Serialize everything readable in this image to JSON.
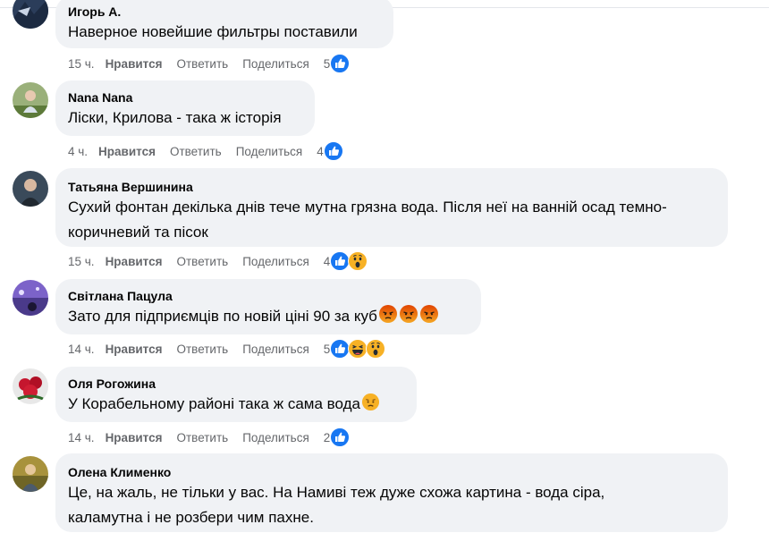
{
  "comments": [
    {
      "author": "Игорь А.",
      "lines": [
        "Наверное новейшие фильтры поставили"
      ],
      "time": "15 ч.",
      "like_label": "Нравится",
      "reply_label": "Ответить",
      "share_label": "Поделиться",
      "reactions_count": "5",
      "reactions": [
        "like-icon"
      ]
    },
    {
      "author": "Nana Nana",
      "lines": [
        "Ліски, Крилова - така ж історія"
      ],
      "time": "4 ч.",
      "like_label": "Нравится",
      "reply_label": "Ответить",
      "share_label": "Поделиться",
      "reactions_count": "4",
      "reactions": [
        "like-icon"
      ]
    },
    {
      "author": "Татьяна Вершинина",
      "lines": [
        "Сухий фонтан декілька днів тече мутна грязна вода. Після неї на ванній осад темно-",
        "коричневий та пісок"
      ],
      "time": "15 ч.",
      "like_label": "Нравится",
      "reply_label": "Ответить",
      "share_label": "Поделиться",
      "reactions_count": "4",
      "reactions": [
        "like-icon",
        "wow-icon"
      ]
    },
    {
      "author": "Світлана Пацула",
      "lines": [
        "Зато для підприємців по новій ціні 90 за куб"
      ],
      "inline_emojis": [
        "angry-emoji",
        "angry-emoji",
        "angry-emoji"
      ],
      "time": "14 ч.",
      "like_label": "Нравится",
      "reply_label": "Ответить",
      "share_label": "Поделиться",
      "reactions_count": "5",
      "reactions": [
        "like-icon",
        "haha-icon",
        "wow-icon"
      ]
    },
    {
      "author": "Оля Рогожина",
      "lines": [
        "У Корабельному районі така ж сама вода"
      ],
      "inline_emojis": [
        "disappointed-emoji"
      ],
      "time": "14 ч.",
      "like_label": "Нравится",
      "reply_label": "Ответить",
      "share_label": "Поделиться",
      "reactions_count": "2",
      "reactions": [
        "like-icon"
      ]
    },
    {
      "author": "Олена Клименко",
      "lines": [
        "Це, на жаль, не тільки у вас. На Намиві теж дуже схожа картина - вода сіра,",
        "каламутна і не розбери чим пахне."
      ]
    }
  ],
  "colors": {
    "bubble": "#f0f2f5",
    "meta_text": "#65676b",
    "like_blue": "#1877f2",
    "emoji_yellow": "#f7b125",
    "angry_red": "#e9710f"
  }
}
